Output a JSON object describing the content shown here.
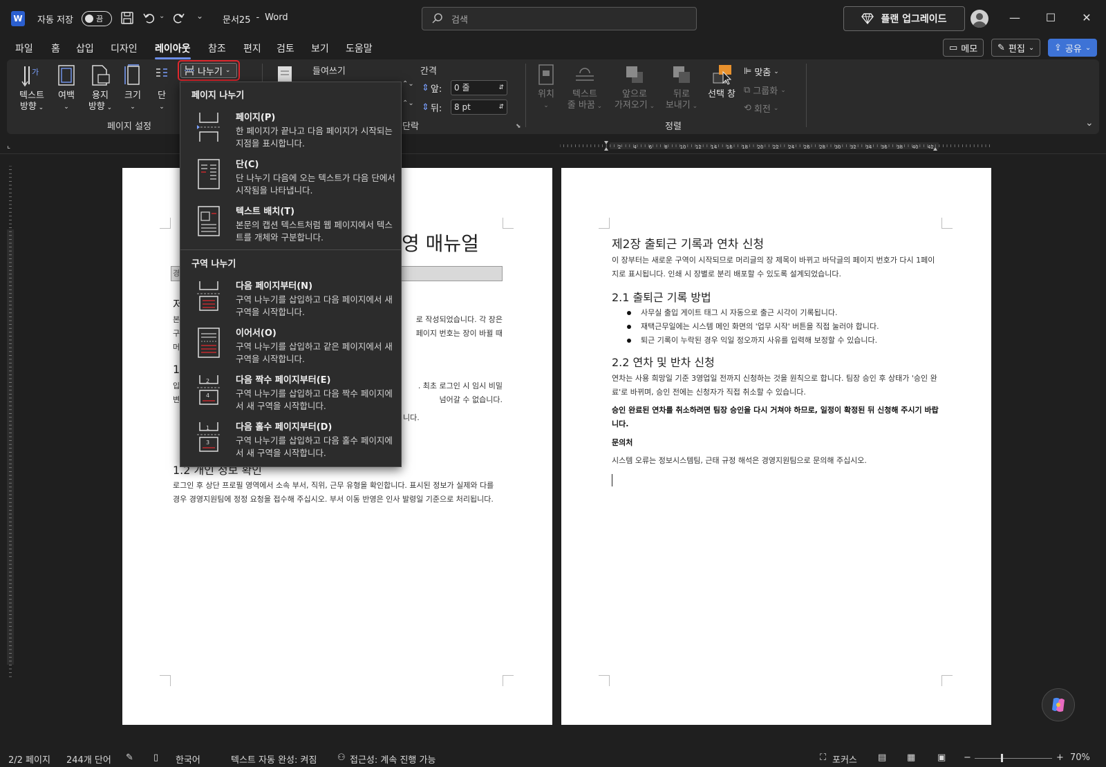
{
  "titlebar": {
    "autosave_label": "자동 저장",
    "autosave_state": "끔",
    "doc_title": "문서25",
    "app_name": "Word",
    "title_sep": "-",
    "search_placeholder": "검색",
    "upgrade_label": "플랜 업그레이드"
  },
  "menu": {
    "tabs": [
      "파일",
      "홈",
      "삽입",
      "디자인",
      "레이아웃",
      "참조",
      "편지",
      "검토",
      "보기",
      "도움말"
    ],
    "active_tab": "레이아웃",
    "memo_label": "메모",
    "edit_label": "편집",
    "share_label": "공유"
  },
  "ribbon": {
    "page_setup": {
      "text_dir": [
        "텍스트",
        "방향"
      ],
      "margins": "여백",
      "orientation": [
        "용지",
        "방향"
      ],
      "size": "크기",
      "columns": "단",
      "breaks": "나누기",
      "group_label": "페이지 설정"
    },
    "paragraph": {
      "indent_label": "들여쓰기",
      "spacing_label": "간격",
      "before_label": "앞:",
      "after_label": "뒤:",
      "before_value": "0 줄",
      "after_value": "8 pt",
      "group_label": "단락"
    },
    "arrange": {
      "position": "위치",
      "wrap_text": [
        "텍스트",
        "줄 바꿈"
      ],
      "bring_forward": [
        "앞으로",
        "가져오기"
      ],
      "send_backward": [
        "뒤로",
        "보내기"
      ],
      "selection_pane": "선택 창",
      "align": "맞춤",
      "group": "그룹화",
      "rotate": "회전",
      "group_label": "정렬"
    }
  },
  "ruler_numbers": [
    "2",
    "4",
    "6",
    "8",
    "10",
    "12",
    "14",
    "16",
    "18",
    "20",
    "22",
    "24",
    "26",
    "28",
    "30",
    "32",
    "34",
    "36",
    "38",
    "40",
    "42"
  ],
  "dropdown": {
    "page_breaks_header": "페이지 나누기",
    "section_breaks_header": "구역 나누기",
    "items": [
      {
        "title": "페이지(P)",
        "desc": "한 페이지가 끝나고 다음 페이지가 시작되는 지점을 표시합니다."
      },
      {
        "title": "단(C)",
        "desc": "단 나누기 다음에 오는 텍스트가 다음 단에서 시작됨을 나타냅니다."
      },
      {
        "title": "텍스트 배치(T)",
        "desc": "본문의 캡션 텍스트처럼 웹 페이지에서 텍스트를 개체와 구분합니다."
      },
      {
        "title": "다음 페이지부터(N)",
        "desc": "구역 나누기를 삽입하고 다음 페이지에서 새 구역을 시작합니다."
      },
      {
        "title": "이어서(O)",
        "desc": "구역 나누기를 삽입하고 같은 페이지에서 새 구역을 시작합니다."
      },
      {
        "title": "다음 짝수 페이지부터(E)",
        "desc": "구역 나누기를 삽입하고 다음 짝수 페이지에서 새 구역을 시작합니다."
      },
      {
        "title": "다음 홀수 페이지부터(D)",
        "desc": "구역 나누기를 삽입하고 다음 홀수 페이지에서 새 구역을 시작합니다."
      }
    ]
  },
  "page1": {
    "title_visible": "영 매뉴얼",
    "gray_box_fragment": "경",
    "frag_h1": "저",
    "p1_left": [
      "본",
      "구",
      "머"
    ],
    "p1_right": [
      "로 작성되었습니다. 각 장은",
      "페이지 번호는 장이 바뀔 때"
    ],
    "sec11_num": "1.",
    "p2_left": [
      "입",
      "변"
    ],
    "p2_right": [
      ". 최초 로그인 시 임시 비밀",
      "넘어갈 수 없습니다."
    ],
    "p3_right": "니다.",
    "sec12_heading": "1.2 개인 정보 확인",
    "sec12_text": "로그인 후 상단 프로필 영역에서 소속 부서, 직위, 근무 유형을 확인합니다. 표시된 정보가 실제와 다를 경우 경영지원팀에 정정 요청을 접수해 주십시오. 부서 이동 반영은 인사 발령일 기준으로 처리됩니다."
  },
  "page2": {
    "h1": "제2장 출퇴근 기록과 연차 신청",
    "intro": "이 장부터는 새로운 구역이 시작되므로 머리글의 장 제목이 바뀌고 바닥글의 페이지 번호가 다시 1페이지로 표시됩니다. 인쇄 시 장별로 분리 배포할 수 있도록 설계되었습니다.",
    "sec21": "2.1 출퇴근 기록 방법",
    "bullets": [
      "사무실 출입 게이트 태그 시 자동으로 출근 시각이 기록됩니다.",
      "재택근무일에는 시스템 메인 화면의 '업무 시작' 버튼을 직접 눌러야 합니다.",
      "퇴근 기록이 누락된 경우 익일 정오까지 사유를 입력해 보정할 수 있습니다."
    ],
    "sec22": "2.2 연차 및 반차 신청",
    "sec22_text": "연차는 사용 희망일 기준 3영업일 전까지 신청하는 것을 원칙으로 합니다. 팀장 승인 후 상태가 '승인 완료'로 바뀌며, 승인 전에는 신청자가 직접 취소할 수 있습니다.",
    "bold_note": "승인 완료된 연차를 취소하려면 팀장 승인을 다시 거쳐야 하므로, 일정이 확정된 뒤 신청해 주시기 바랍니다.",
    "contact_heading": "문의처",
    "contact_text": "시스템 오류는 정보시스템팀, 근태 규정 해석은 경영지원팀으로 문의해 주십시오."
  },
  "statusbar": {
    "pages": "2/2 페이지",
    "words": "244개 단어",
    "language": "한국어",
    "autocomplete": "텍스트 자동 완성: 켜짐",
    "accessibility": "접근성: 계속 진행 가능",
    "focus": "포커스",
    "zoom": "70%"
  },
  "colors": {
    "accent": "#6c8ee8",
    "share": "#3e73d6",
    "highlight_border": "#e0282e",
    "selection_pane_icon": "#e8912d"
  }
}
